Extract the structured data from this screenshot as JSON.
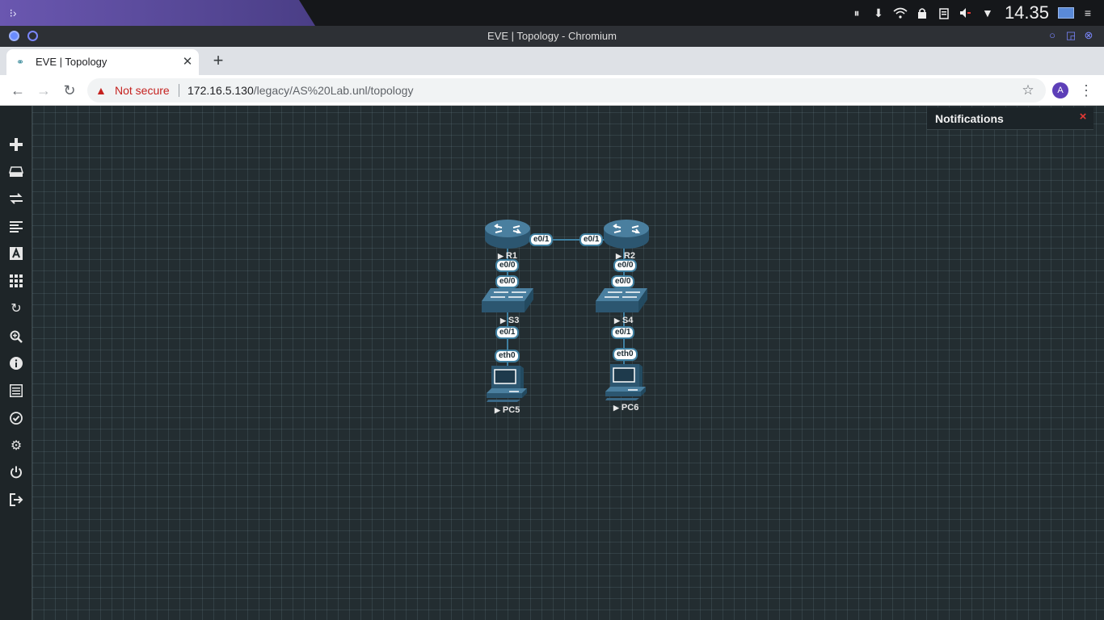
{
  "system_bar": {
    "clock": "14.35",
    "tray_icons": [
      "pause-icon",
      "download-icon",
      "wifi-icon",
      "lock-icon",
      "clipboard-icon",
      "volume-icon",
      "dropdown-icon"
    ]
  },
  "window": {
    "title": "EVE | Topology - Chromium"
  },
  "tab": {
    "title": "EVE | Topology",
    "close": "✕",
    "new_tab": "+"
  },
  "address_bar": {
    "security_label": "Not secure",
    "url_host": "172.16.5.130",
    "url_path": "/legacy/AS%20Lab.unl/topology",
    "avatar_letter": "A"
  },
  "notifications": {
    "title": "Notifications",
    "close": "×"
  },
  "sidebar": {
    "items": [
      "add-icon",
      "nodes-icon",
      "networks-icon",
      "startup-configs-icon",
      "text-icon",
      "grid-icon",
      "refresh-icon",
      "zoom-icon",
      "info-icon",
      "lab-list-icon",
      "status-icon",
      "settings-icon",
      "power-icon",
      "logout-icon"
    ]
  },
  "topology": {
    "nodes": [
      {
        "name": "R1",
        "type": "router"
      },
      {
        "name": "R2",
        "type": "router"
      },
      {
        "name": "S3",
        "type": "switch"
      },
      {
        "name": "S4",
        "type": "switch"
      },
      {
        "name": "PC5",
        "type": "pc"
      },
      {
        "name": "PC6",
        "type": "pc"
      }
    ],
    "interfaces": {
      "r1_to_r2": "e0/1",
      "r2_to_r1": "e0/1",
      "r1_to_s3": "e0/0",
      "s3_to_r1": "e0/0",
      "r2_to_s4": "e0/0",
      "s4_to_r2": "e0/0",
      "s3_to_pc5": "e0/1",
      "pc5_to_s3": "eth0",
      "s4_to_pc6": "e0/1",
      "pc6_to_s4": "eth0"
    },
    "colors": {
      "node": "#3f6f8e",
      "link": "#3f7fa0"
    }
  }
}
